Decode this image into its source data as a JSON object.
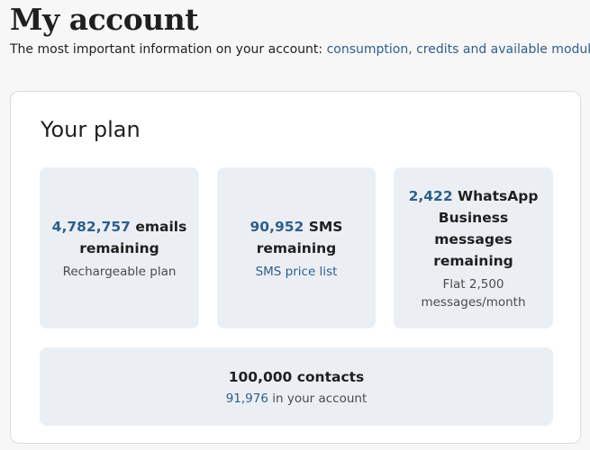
{
  "header": {
    "title": "My account",
    "subtitle_text": "The most important information on your account: ",
    "subtitle_link": "consumption, credits and available modules",
    "subtitle_link_icon": "external-link-icon"
  },
  "plan": {
    "title": "Your plan",
    "emails": {
      "number": "4,782,757",
      "label": " emails remaining",
      "sub": "Rechargeable plan"
    },
    "sms": {
      "number": "90,952",
      "label": " SMS remaining",
      "link": "SMS price list"
    },
    "whatsapp": {
      "number": "2,422",
      "label": " WhatsApp Business messages remaining",
      "sub": "Flat 2,500 messages/month"
    },
    "contacts": {
      "title": "100,000 contacts",
      "count": "91,976",
      "suffix": " in your account"
    }
  },
  "colors": {
    "link": "#2f5e8c",
    "tile_bg": "#ebeff4",
    "card_bg": "#ffffff",
    "page_bg": "#f7f7f7"
  }
}
